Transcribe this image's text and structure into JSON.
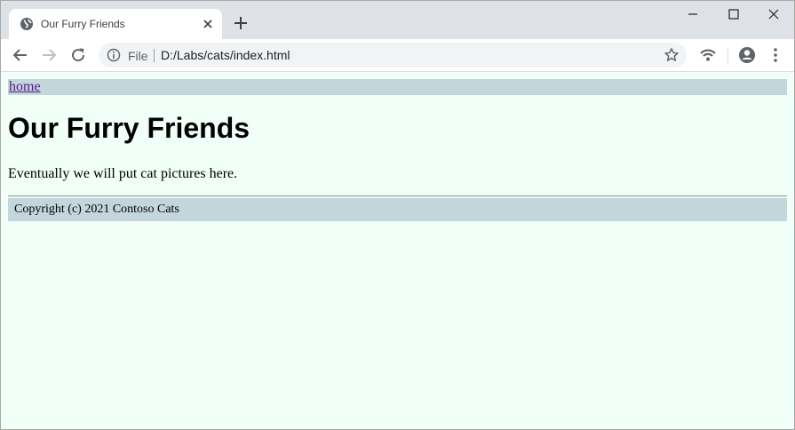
{
  "browser": {
    "tab": {
      "title": "Our Furry Friends"
    },
    "address_bar": {
      "scheme_label": "File",
      "url": "D:/Labs/cats/index.html"
    }
  },
  "page": {
    "nav": {
      "home_link": "home"
    },
    "heading": "Our Furry Friends",
    "paragraph": "Eventually we will put cat pictures here.",
    "footer": "Copyright (c) 2021 Contoso Cats"
  },
  "colors": {
    "page_background": "#f0fff8",
    "bar_background": "#c2d6dc",
    "link": "#551a8b"
  }
}
